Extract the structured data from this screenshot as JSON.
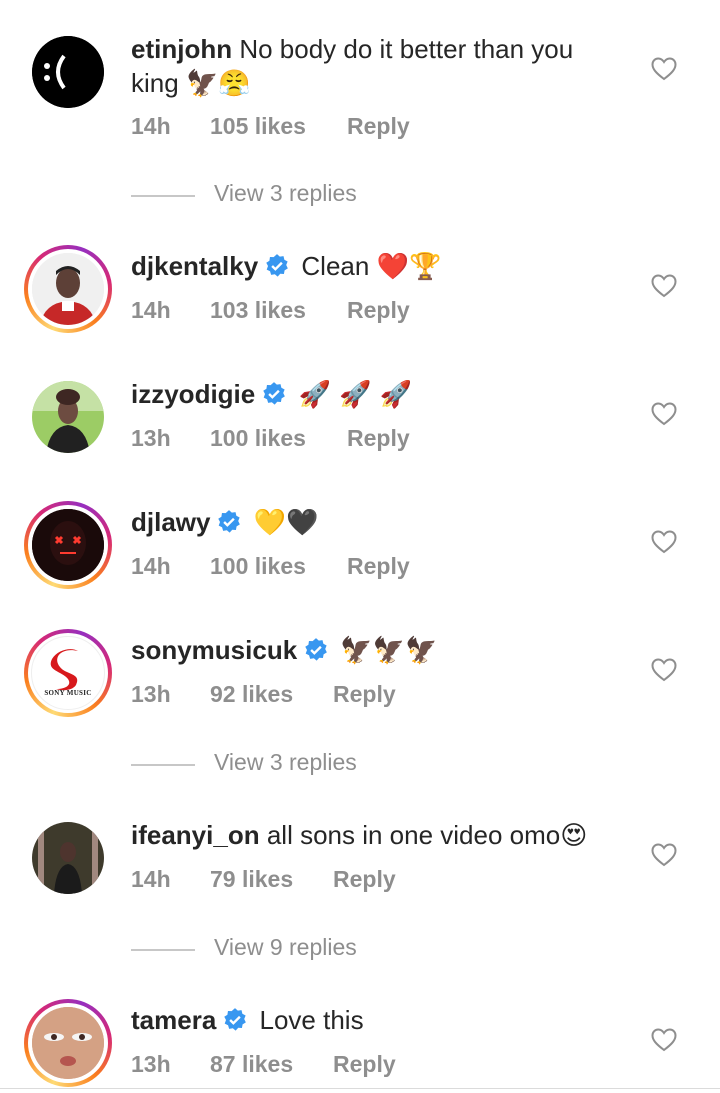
{
  "comments": [
    {
      "username": "etinjohn",
      "text": "No body do it better than you",
      "text_line2": "king",
      "emoji": "🦅😤",
      "time": "14h",
      "likes": "105 likes",
      "reply": "Reply",
      "verified": false
    },
    {
      "username": "djkentalky",
      "text": "Clean",
      "emoji": "❤️🏆",
      "time": "14h",
      "likes": "103 likes",
      "reply": "Reply",
      "verified": true
    },
    {
      "username": "izzyodigie",
      "text": "",
      "emoji": "🚀 🚀 🚀",
      "time": "13h",
      "likes": "100 likes",
      "reply": "Reply",
      "verified": true
    },
    {
      "username": "djlawy",
      "text": "",
      "emoji": "💛🖤",
      "time": "14h",
      "likes": "100 likes",
      "reply": "Reply",
      "verified": true
    },
    {
      "username": "sonymusicuk",
      "text": "",
      "emoji": "🦅🦅🦅",
      "time": "13h",
      "likes": "92 likes",
      "reply": "Reply",
      "verified": true,
      "avatar_text": "SONY MUSIC"
    },
    {
      "username": "ifeanyi_on",
      "text": "all sons in one video omo",
      "emoji": "😍",
      "time": "14h",
      "likes": "79 likes",
      "reply": "Reply",
      "verified": false
    },
    {
      "username": "tamera",
      "text": "Love this",
      "emoji": "",
      "time": "13h",
      "likes": "87 likes",
      "reply": "Reply",
      "verified": true
    }
  ],
  "view_replies": [
    "View 3 replies",
    "View 3 replies",
    "View 9 replies"
  ],
  "colors": {
    "verified_blue": "#3897f0",
    "meta_gray": "#8e8e8e",
    "text": "#262626"
  },
  "icons": {
    "like": "heart-outline-icon",
    "verified": "verified-badge-icon"
  }
}
